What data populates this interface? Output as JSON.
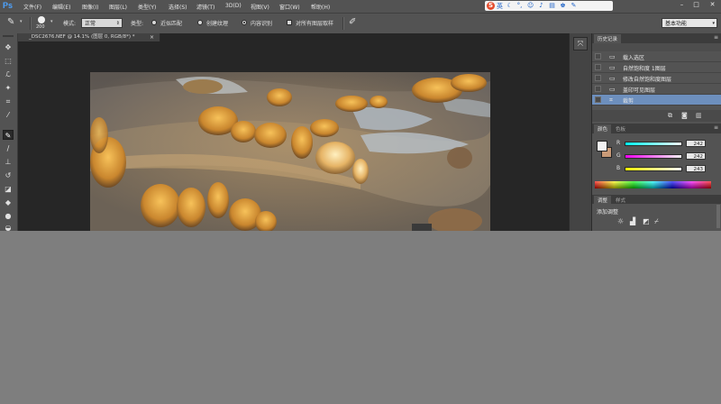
{
  "app": {
    "logo": "Ps",
    "menu": [
      "文件(F)",
      "编辑(E)",
      "图像(I)",
      "图层(L)",
      "类型(Y)",
      "选择(S)",
      "滤镜(T)",
      "3D(D)",
      "视图(V)",
      "窗口(W)",
      "帮助(H)"
    ],
    "ime_label": "英"
  },
  "options": {
    "brush_size": "200",
    "mode_label": "模式:",
    "mode_value": "正常",
    "type_label": "类型:",
    "radio_proximity": "近似匹配",
    "radio_texture": "创建纹理",
    "radio_content_aware": "内容识别",
    "sample_all": "对所有图层取样",
    "workspace": "基本功能"
  },
  "document": {
    "tab_title": "_DSC2676.NEF @ 14.1% (图层 0, RGB/8*) *"
  },
  "panels": {
    "history_tab": "历史记录",
    "history": [
      {
        "label": "载入选区",
        "selected": false
      },
      {
        "label": "自然饱和度 1图层",
        "selected": false
      },
      {
        "label": "修改自然饱和度图层",
        "selected": false
      },
      {
        "label": "盖印可见图层",
        "selected": false
      },
      {
        "label": "裁剪",
        "selected": true
      }
    ],
    "color_tab": "颜色",
    "swatches_tab": "色板",
    "rgb": [
      {
        "channel": "R",
        "value": "242"
      },
      {
        "channel": "G",
        "value": "242"
      },
      {
        "channel": "B",
        "value": "243"
      }
    ],
    "adjust_tab": "调整",
    "styles_tab": "样式",
    "add_adjustment": "添加调整"
  },
  "colors": {
    "ui_dark": "#535353",
    "selection": "#6d8fbd",
    "active_tool_marker": "#e01818"
  }
}
